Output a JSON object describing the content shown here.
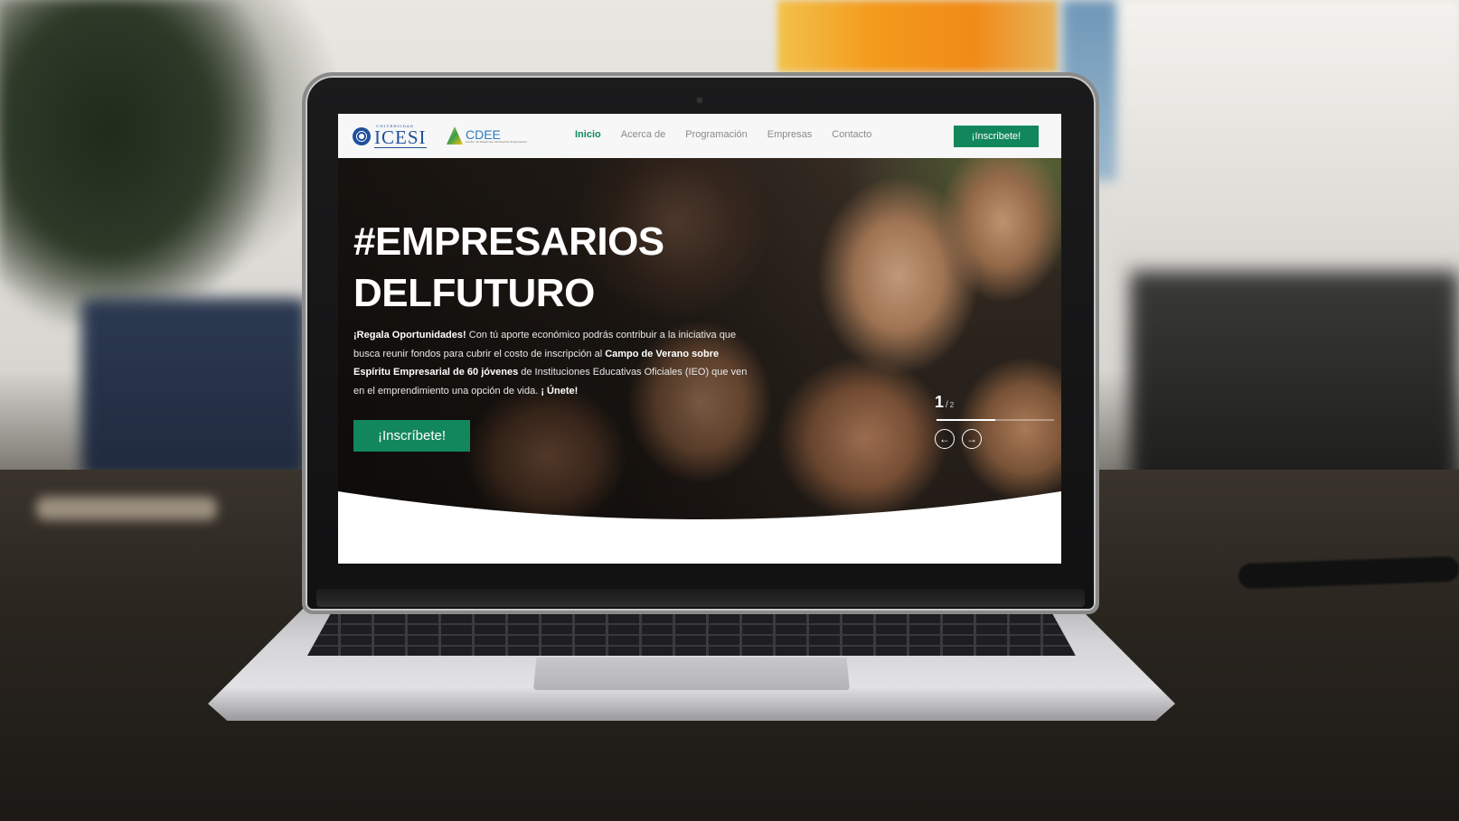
{
  "navbar": {
    "logo_icesi": {
      "small": "UNIVERSIDAD",
      "big": "ICESI"
    },
    "logo_cdee": {
      "big": "CDEE",
      "small": "Centro de Desarrollo del Espíritu Empresarial"
    },
    "links": [
      {
        "label": "Inicio",
        "active": true
      },
      {
        "label": "Acerca de",
        "active": false
      },
      {
        "label": "Programación",
        "active": false
      },
      {
        "label": "Empresas",
        "active": false
      },
      {
        "label": "Contacto",
        "active": false
      }
    ],
    "cta_label": "¡Inscribete!"
  },
  "hero": {
    "title_line1": "#EMPRESARIOS",
    "title_line2": "DELFUTURO",
    "text": {
      "p1_bold": "¡Regala Oportunidades!",
      "p1": " Con tú aporte económico podrás contribuir a la iniciativa que busca reunir fondos para cubrir el costo de inscripción al ",
      "p2_bold": "Campo de Verano sobre Espíritu Empresarial de 60 jóvenes",
      "p2": " de Instituciones Educativas Oficiales (IEO) que ven en el emprendimiento una opción de vida. ",
      "p3_bold": "¡ Únete!"
    },
    "cta_label": "¡Inscríbete!"
  },
  "slider": {
    "current": "1",
    "separator": "/",
    "total": "2",
    "progress": 0.5,
    "prev_icon": "arrow-left-icon",
    "next_icon": "arrow-right-icon"
  },
  "colors": {
    "brand_green": "#13875c",
    "icesi_blue": "#1f4f9c",
    "cdee_blue": "#2c7bbf",
    "nav_text": "#8a8a8a"
  }
}
